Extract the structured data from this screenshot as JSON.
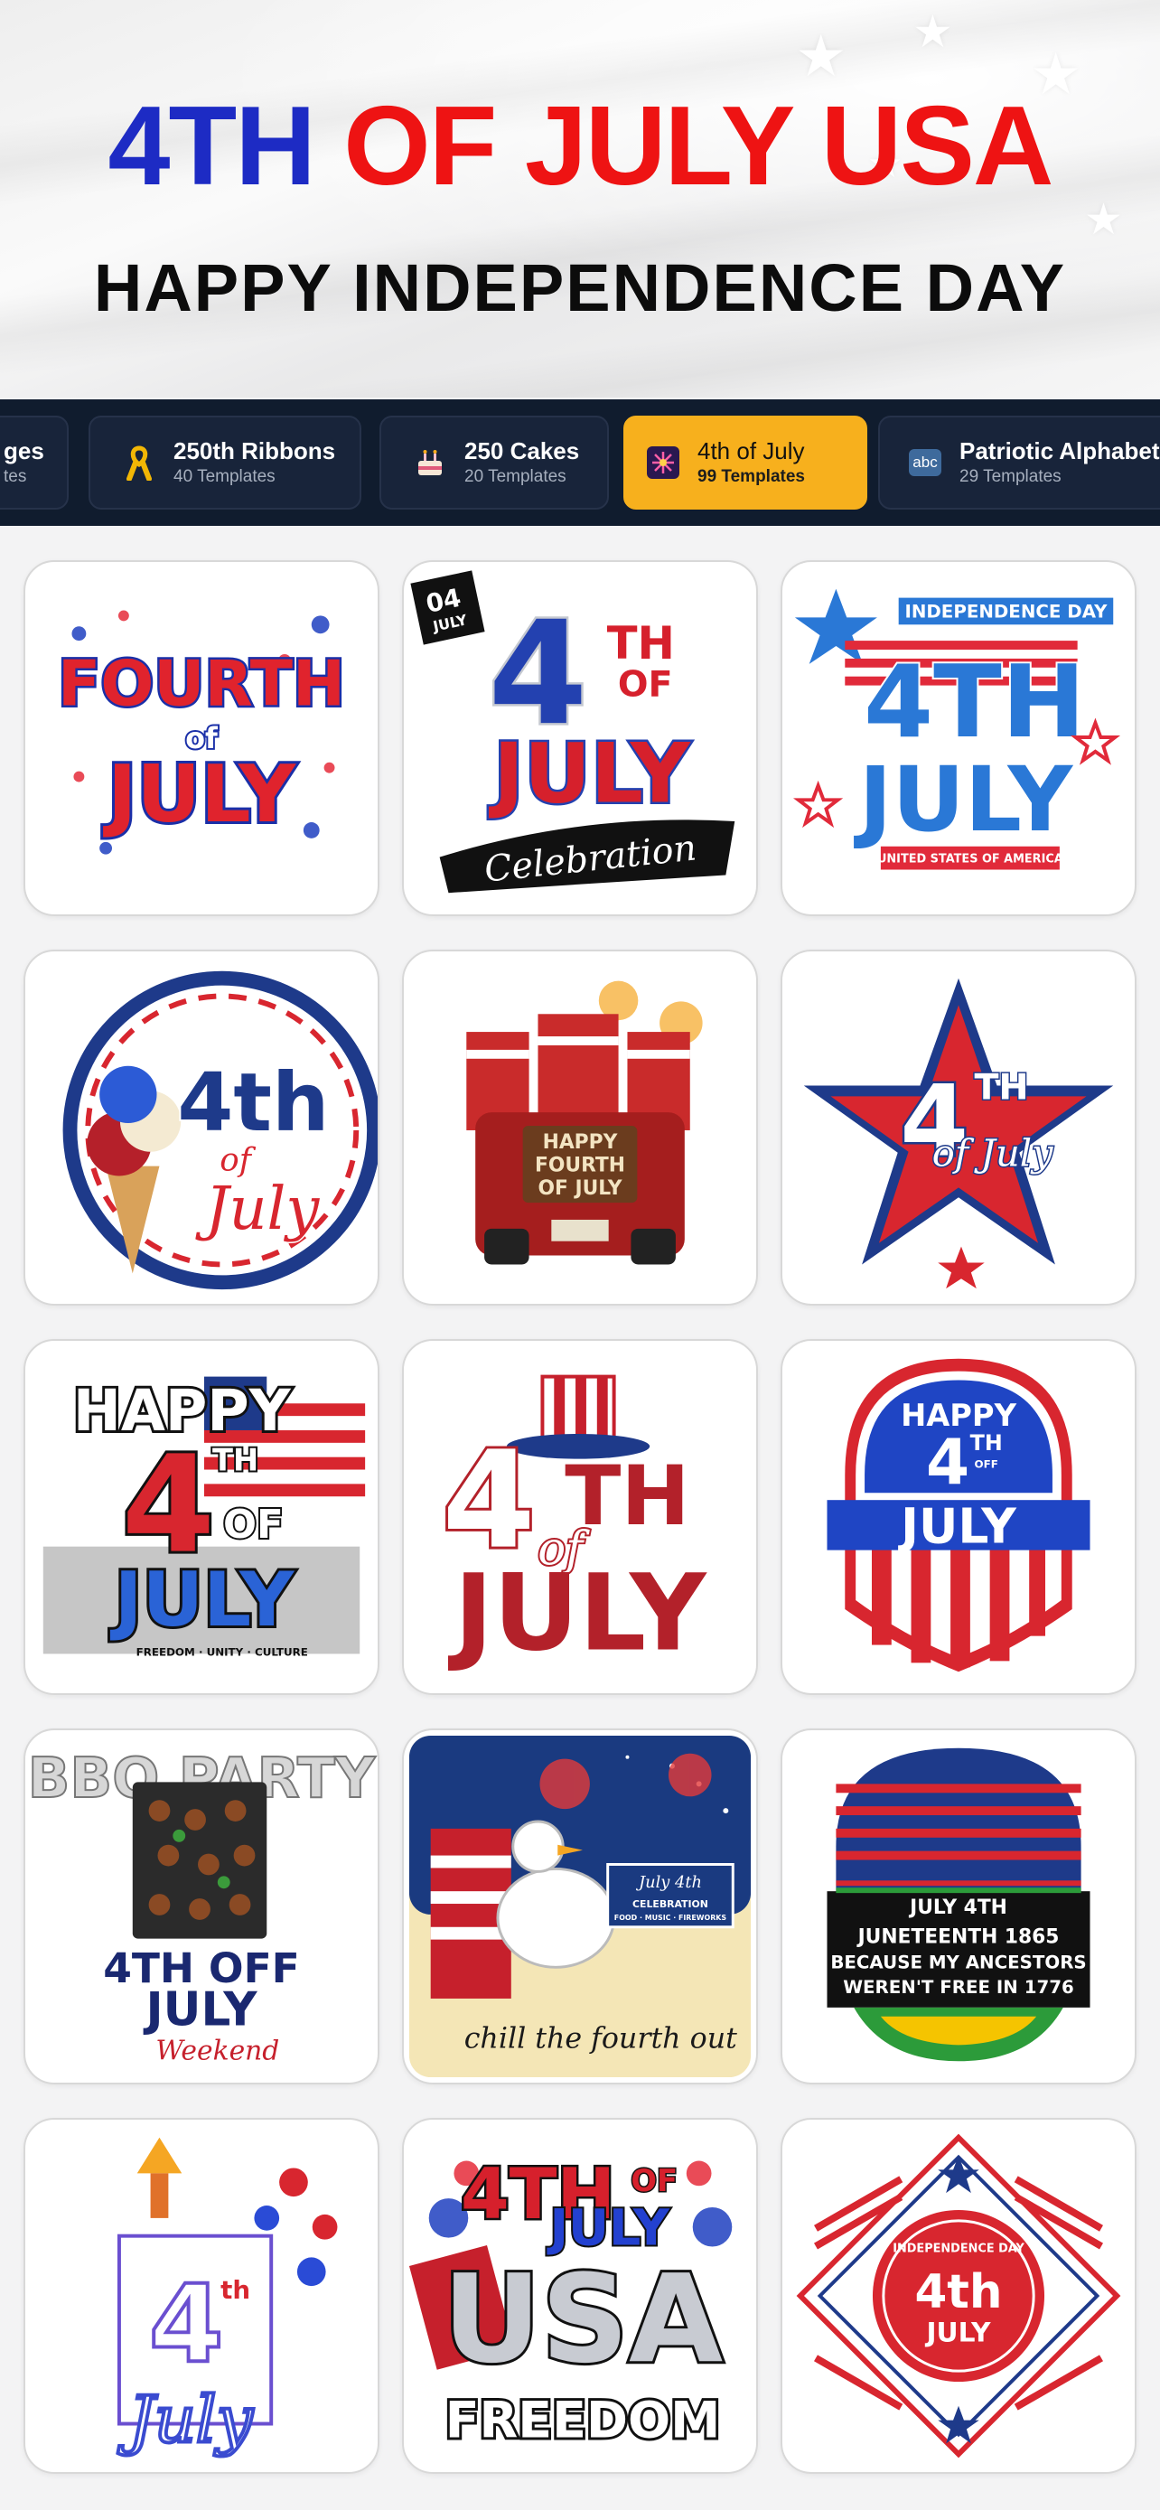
{
  "header": {
    "title_blue": "4TH",
    "title_red": "OF JULY USA",
    "subtitle": "HAPPY INDEPENDENCE DAY"
  },
  "categories": [
    {
      "label": "ges",
      "count": "tes",
      "icon": "badge-icon",
      "active": false
    },
    {
      "label": "250th Ribbons",
      "count": "40 Templates",
      "icon": "ribbon-icon",
      "active": false
    },
    {
      "label": "250 Cakes",
      "count": "20 Templates",
      "icon": "cake-icon",
      "active": false
    },
    {
      "label": "4th of July",
      "count": "99 Templates",
      "icon": "fireworks-icon",
      "active": true
    },
    {
      "label": "Patriotic Alphabets",
      "count": "29 Templates",
      "icon": "abc-icon",
      "active": false
    }
  ],
  "colors": {
    "blue": "#1d2bc4",
    "red": "#ee1313",
    "navy_bar": "#101c2e",
    "active_chip": "#f7b01d"
  },
  "templates": [
    {
      "name": "fourth-of-july-balloon",
      "lines": [
        "FOURTH",
        "of",
        "JULY"
      ]
    },
    {
      "name": "4th-of-july-celebration",
      "lines": [
        "04",
        "JULY",
        "4",
        "TH",
        "OF",
        "JULY",
        "Celebration"
      ]
    },
    {
      "name": "independence-day-4th-july",
      "lines": [
        "INDEPENDENCE DAY",
        "4TH",
        "JULY",
        "UNITED STATES OF AMERICA"
      ]
    },
    {
      "name": "ice-cream-4th-of-july",
      "lines": [
        "4th",
        "of",
        "July"
      ]
    },
    {
      "name": "happy-fourth-truck",
      "lines": [
        "HAPPY",
        "FOURTH",
        "OF JULY"
      ]
    },
    {
      "name": "star-4th-of-july",
      "lines": [
        "4",
        "TH",
        "of July"
      ]
    },
    {
      "name": "happy-4th-of-july-graffiti",
      "lines": [
        "HAPPY",
        "4",
        "TH",
        "OF",
        "JULY",
        "FREEDOM · UNITY · CULTURE"
      ]
    },
    {
      "name": "4th-of-july-uncle-sam-hat",
      "lines": [
        "4",
        "TH",
        "of",
        "JULY"
      ]
    },
    {
      "name": "happy-4th-off-july-shield",
      "lines": [
        "HAPPY",
        "4",
        "TH",
        "OFF",
        "JULY"
      ]
    },
    {
      "name": "bbq-party-4th-off-july",
      "lines": [
        "BBQ PARTY",
        "4TH OFF",
        "JULY",
        "Weekend"
      ]
    },
    {
      "name": "chill-the-fourth-out",
      "lines": [
        "July 4th",
        "CELEBRATION",
        "FOOD · MUSIC · FIREWORKS",
        "chill the fourth out"
      ]
    },
    {
      "name": "juneteenth-1865",
      "lines": [
        "JULY 4TH",
        "JUNETEENTH 1865",
        "BECAUSE MY ANCESTORS",
        "WEREN'T FREE IN 1776"
      ]
    },
    {
      "name": "liberty-4th-july",
      "lines": [
        "4",
        "th",
        "July"
      ]
    },
    {
      "name": "4th-of-july-usa-freedom",
      "lines": [
        "4TH",
        "OF",
        "JULY",
        "USA",
        "FREEDOM"
      ]
    },
    {
      "name": "independence-day-4th-july-badge",
      "lines": [
        "INDEPENDENCE DAY",
        "4th",
        "JULY"
      ]
    }
  ]
}
